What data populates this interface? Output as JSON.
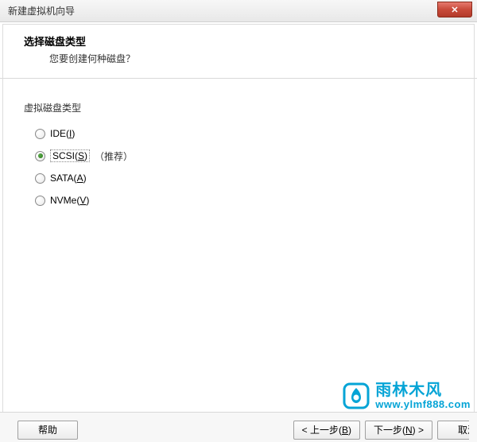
{
  "titlebar": {
    "title": "新建虚拟机向导"
  },
  "header": {
    "title": "选择磁盘类型",
    "subtitle": "您要创建何种磁盘？"
  },
  "section": {
    "label": "虚拟磁盘类型"
  },
  "options": {
    "ide": {
      "pre": "IDE(",
      "key": "I",
      "post": ")",
      "checked": false,
      "selected": false,
      "suffix": ""
    },
    "scsi": {
      "pre": "SCSI(",
      "key": "S",
      "post": ")",
      "checked": true,
      "selected": true,
      "suffix": "（推荐）"
    },
    "sata": {
      "pre": "SATA(",
      "key": "A",
      "post": ")",
      "checked": false,
      "selected": false,
      "suffix": ""
    },
    "nvme": {
      "pre": "NVMe(",
      "key": "V",
      "post": ")",
      "checked": false,
      "selected": false,
      "suffix": ""
    }
  },
  "buttons": {
    "help": "帮助",
    "back_pre": "< 上一步(",
    "back_key": "B",
    "back_post": ")",
    "next_pre": "下一步(",
    "next_key": "N",
    "next_post": ") >",
    "cancel": "取消"
  },
  "watermark": {
    "cn": "雨林木风",
    "url": "www.ylmf888.com"
  }
}
